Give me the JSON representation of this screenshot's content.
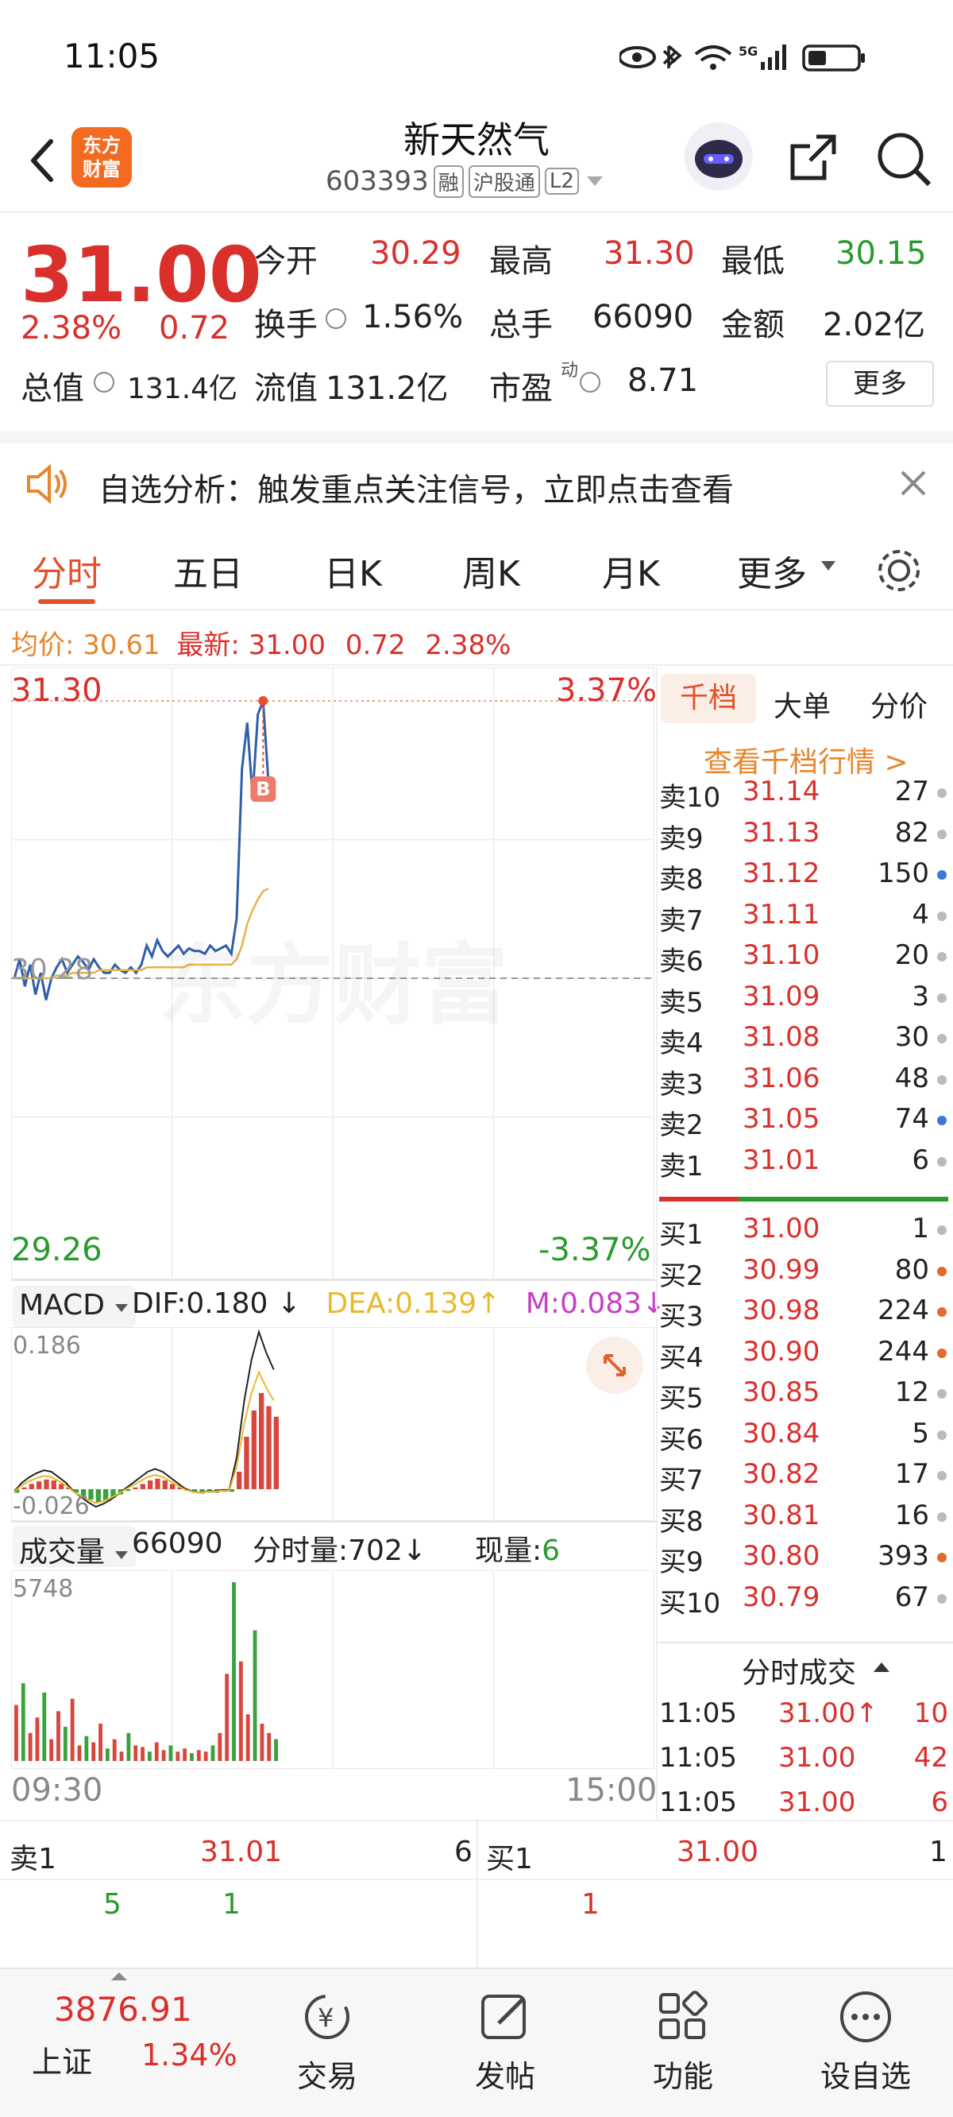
{
  "status": {
    "time": "11:05",
    "signal_label": "5G"
  },
  "header": {
    "title": "新天然气",
    "code": "603393",
    "badges": [
      "融",
      "沪股通",
      "L2"
    ],
    "logo_text": "东方\n财富"
  },
  "quote": {
    "price": "31.00",
    "change_pct": "2.38%",
    "change": "0.72",
    "fields": {
      "open_label": "今开",
      "open": "30.29",
      "high_label": "最高",
      "high": "31.30",
      "low_label": "最低",
      "low": "30.15",
      "turnover_label": "换手",
      "turnover": "1.56%",
      "volume_label": "总手",
      "volume": "66090",
      "amount_label": "金额",
      "amount": "2.02亿",
      "mktcap_label": "总值",
      "mktcap": "131.4亿",
      "float_label": "流值",
      "float": "131.2亿",
      "pe_label": "市盈",
      "pe_sup": "动",
      "pe": "8.71"
    },
    "more_button": "更多"
  },
  "banner": {
    "text": "自选分析：触发重点关注信号，立即点击查看"
  },
  "tabs": [
    "分时",
    "五日",
    "日K",
    "周K",
    "月K",
    "更多"
  ],
  "avg_line": {
    "avg_label": "均价:",
    "avg": "30.61",
    "latest_label": "最新:",
    "latest": "31.00",
    "chg": "0.72",
    "pct": "2.38%"
  },
  "chart_data": {
    "type": "line",
    "title": "",
    "y_high": "31.30",
    "y_high_pct": "3.37%",
    "y_low": "29.26",
    "y_low_pct": "-3.37%",
    "y_mid": "30.28",
    "x_start": "09:30",
    "x_end": "15:00",
    "ylim": [
      29.26,
      31.3
    ],
    "watermark": "东方财富",
    "buy_marker": "B",
    "series": [
      {
        "name": "price",
        "values": [
          30.28,
          30.35,
          30.25,
          30.33,
          30.22,
          30.3,
          30.2,
          30.28,
          30.32,
          30.35,
          30.3,
          30.33,
          30.36,
          30.34,
          30.31,
          30.35,
          30.32,
          30.3,
          30.3,
          30.33,
          30.31,
          30.3,
          30.32,
          30.3,
          30.33,
          30.4,
          30.36,
          30.42,
          30.38,
          30.36,
          30.38,
          30.4,
          30.37,
          30.39,
          30.38,
          30.38,
          30.37,
          30.4,
          30.38,
          30.39,
          30.4,
          30.37,
          30.5,
          31.05,
          31.22,
          30.95,
          31.25,
          31.3,
          31.0
        ]
      },
      {
        "name": "avg",
        "values": [
          30.28,
          30.28,
          30.28,
          30.28,
          30.28,
          30.28,
          30.28,
          30.28,
          30.29,
          30.29,
          30.29,
          30.3,
          30.3,
          30.3,
          30.3,
          30.3,
          30.31,
          30.31,
          30.31,
          30.31,
          30.31,
          30.31,
          30.31,
          30.31,
          30.31,
          30.32,
          30.32,
          30.32,
          30.32,
          30.32,
          30.32,
          30.32,
          30.32,
          30.33,
          30.33,
          30.33,
          30.33,
          30.33,
          30.33,
          30.33,
          30.33,
          30.33,
          30.35,
          30.4,
          30.48,
          30.53,
          30.57,
          30.6,
          30.61
        ]
      }
    ]
  },
  "macd": {
    "selector": "MACD",
    "dif_label": "DIF:",
    "dif": "0.180",
    "dea_label": "DEA:",
    "dea": "0.139",
    "m_label": "M:",
    "m": "0.083",
    "top_label": "0.186",
    "bottom_label": "-0.026",
    "bars": [
      -0.004,
      0.002,
      0.006,
      0.009,
      0.011,
      0.01,
      0.006,
      0.002,
      -0.004,
      -0.008,
      -0.012,
      -0.015,
      -0.013,
      -0.01,
      -0.006,
      -0.002,
      0.002,
      0.006,
      0.01,
      0.012,
      0.01,
      0.006,
      0.002,
      -0.002,
      -0.004,
      -0.005,
      -0.004,
      -0.004,
      -0.003,
      -0.003,
      0.02,
      0.06,
      0.09,
      0.11,
      0.095,
      0.083
    ]
  },
  "volume": {
    "selector": "成交量",
    "total": "66090",
    "fs_label": "分时量:",
    "fs": "702",
    "now_label": "现量:",
    "now": "6",
    "max_label": "5748",
    "bars": [
      1800,
      2500,
      900,
      1400,
      2200,
      700,
      1600,
      1100,
      2000,
      500,
      800,
      600,
      1200,
      400,
      700,
      300,
      900,
      500,
      450,
      300,
      600,
      350,
      500,
      300,
      400,
      250,
      350,
      300,
      500,
      900,
      2800,
      5748,
      3200,
      1500,
      4200,
      1200,
      900,
      702
    ]
  },
  "depth": {
    "tabs": [
      "千档",
      "大单",
      "分价"
    ],
    "link": "查看千档行情 >",
    "asks": [
      {
        "label": "卖10",
        "price": "31.14",
        "vol": "27",
        "dot": "#bbbbbb"
      },
      {
        "label": "卖9",
        "price": "31.13",
        "vol": "82",
        "dot": "#bbbbbb"
      },
      {
        "label": "卖8",
        "price": "31.12",
        "vol": "150",
        "dot": "#3b78d8"
      },
      {
        "label": "卖7",
        "price": "31.11",
        "vol": "4",
        "dot": "#bbbbbb"
      },
      {
        "label": "卖6",
        "price": "31.10",
        "vol": "20",
        "dot": "#bbbbbb"
      },
      {
        "label": "卖5",
        "price": "31.09",
        "vol": "3",
        "dot": "#bbbbbb"
      },
      {
        "label": "卖4",
        "price": "31.08",
        "vol": "30",
        "dot": "#bbbbbb"
      },
      {
        "label": "卖3",
        "price": "31.06",
        "vol": "48",
        "dot": "#bbbbbb"
      },
      {
        "label": "卖2",
        "price": "31.05",
        "vol": "74",
        "dot": "#3b78d8"
      },
      {
        "label": "卖1",
        "price": "31.01",
        "vol": "6",
        "dot": "#bbbbbb"
      }
    ],
    "bids": [
      {
        "label": "买1",
        "price": "31.00",
        "vol": "1",
        "dot": "#bbbbbb"
      },
      {
        "label": "买2",
        "price": "30.99",
        "vol": "80",
        "dot": "#e26a2c"
      },
      {
        "label": "买3",
        "price": "30.98",
        "vol": "224",
        "dot": "#e26a2c"
      },
      {
        "label": "买4",
        "price": "30.90",
        "vol": "244",
        "dot": "#e26a2c"
      },
      {
        "label": "买5",
        "price": "30.85",
        "vol": "12",
        "dot": "#bbbbbb"
      },
      {
        "label": "买6",
        "price": "30.84",
        "vol": "5",
        "dot": "#bbbbbb"
      },
      {
        "label": "买7",
        "price": "30.82",
        "vol": "17",
        "dot": "#bbbbbb"
      },
      {
        "label": "买8",
        "price": "30.81",
        "vol": "16",
        "dot": "#bbbbbb"
      },
      {
        "label": "买9",
        "price": "30.80",
        "vol": "393",
        "dot": "#e26a2c"
      },
      {
        "label": "买10",
        "price": "30.79",
        "vol": "67",
        "dot": "#bbbbbb"
      }
    ],
    "trades_title": "分时成交",
    "trades": [
      {
        "time": "11:05",
        "price": "31.00↑",
        "vol": "10"
      },
      {
        "time": "11:05",
        "price": "31.00",
        "vol": "42"
      },
      {
        "time": "11:05",
        "price": "31.00",
        "vol": "6"
      }
    ]
  },
  "bottom_quote": {
    "sell_label": "卖1",
    "sell_price": "31.01",
    "sell_vol": "6",
    "buy_label": "买1",
    "buy_price": "31.00",
    "buy_vol": "1",
    "row2_a": "5",
    "row2_b": "1",
    "row2_c": "1"
  },
  "nav": {
    "index_value": "3876.91",
    "index_name": "上证",
    "index_pct": "1.34%",
    "items": [
      "交易",
      "发帖",
      "功能",
      "设自选"
    ]
  }
}
